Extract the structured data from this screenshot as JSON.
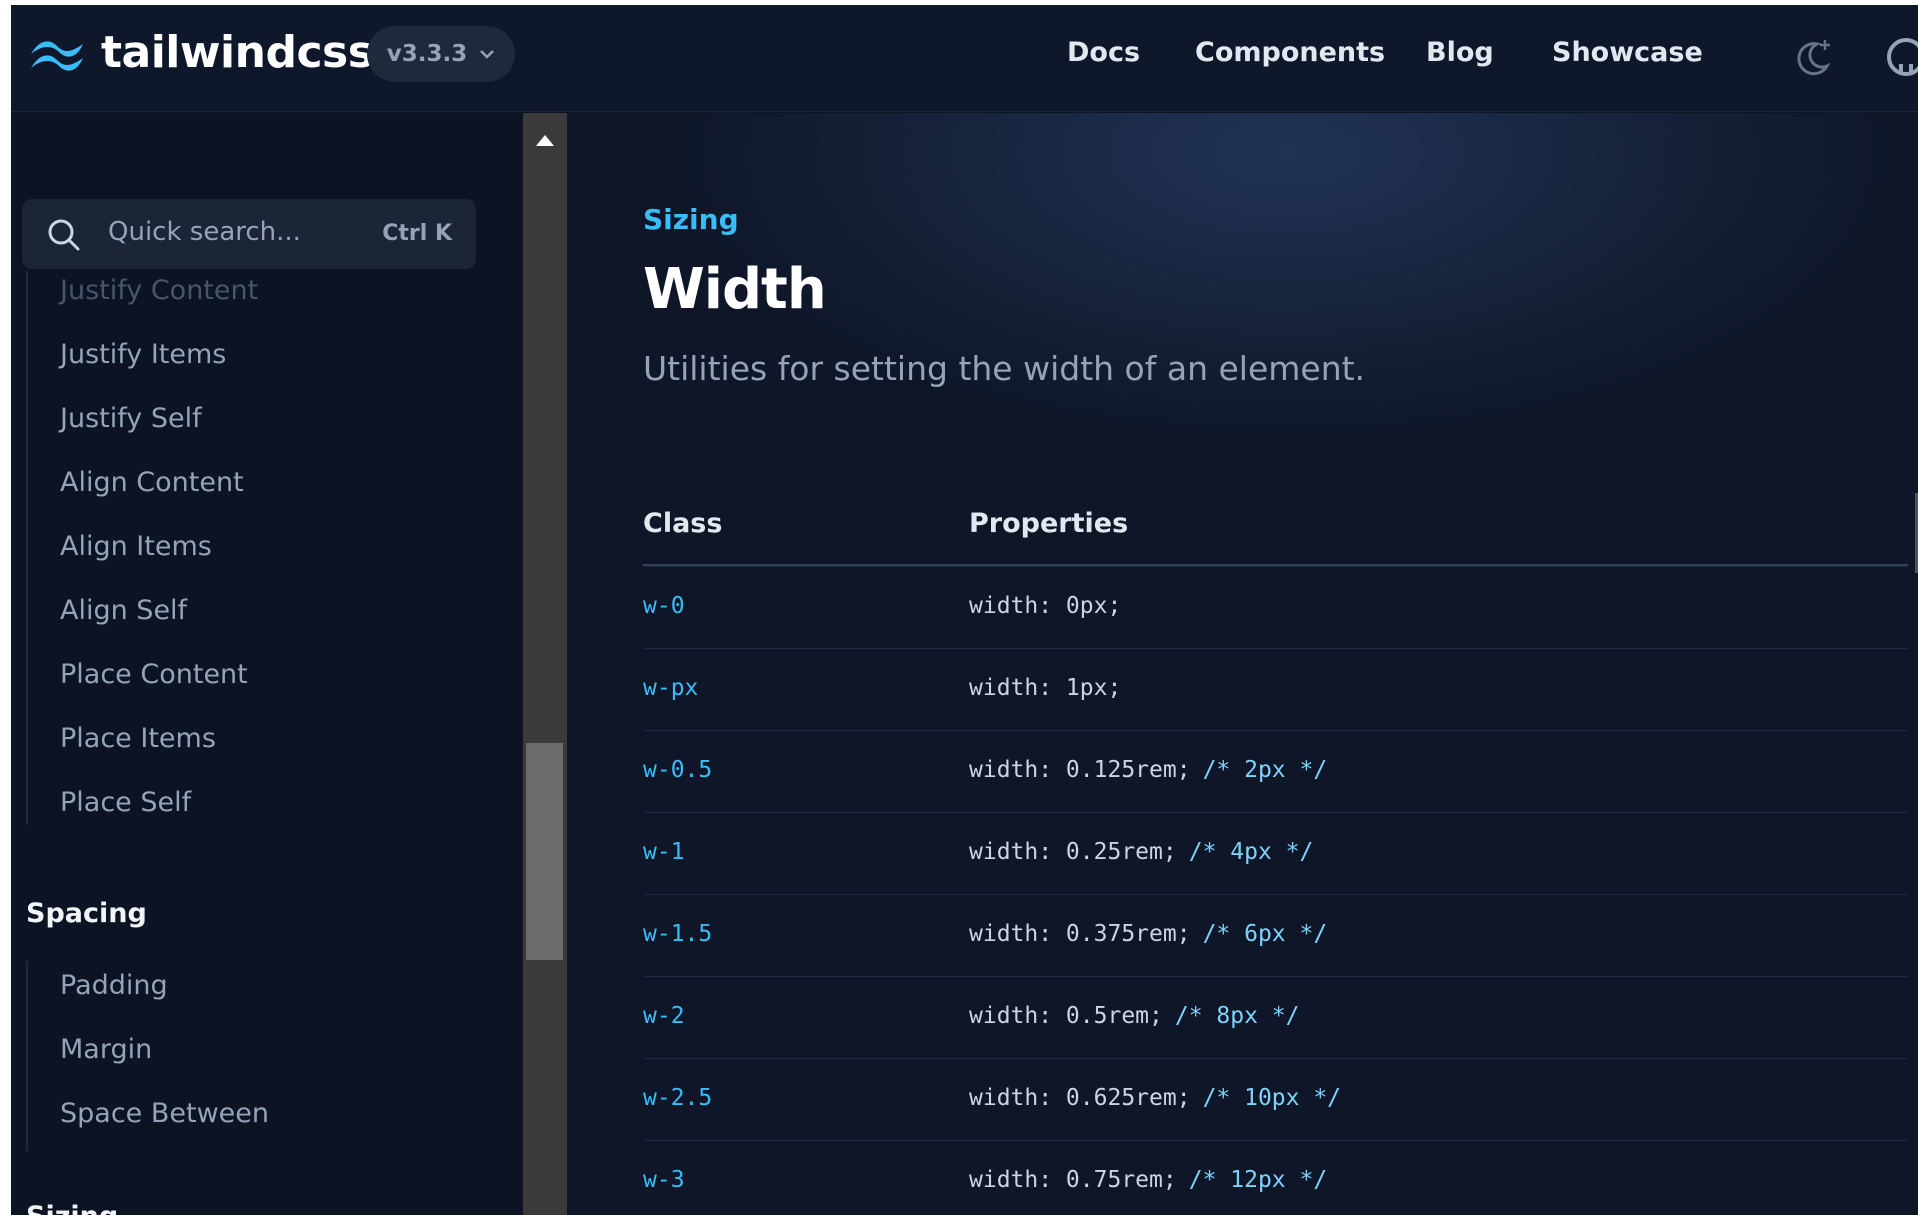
{
  "header": {
    "logo_text": "tailwindcss",
    "version": "v3.3.3",
    "nav": [
      "Docs",
      "Components",
      "Blog",
      "Showcase"
    ]
  },
  "sidebar": {
    "search": {
      "placeholder": "Quick search...",
      "shortcut": "Ctrl K"
    },
    "layout_items_partial": [
      "Justify Content"
    ],
    "items": [
      "Justify Items",
      "Justify Self",
      "Align Content",
      "Align Items",
      "Align Self",
      "Place Content",
      "Place Items",
      "Place Self"
    ],
    "spacing": {
      "heading": "Spacing",
      "items": [
        "Padding",
        "Margin",
        "Space Between"
      ]
    },
    "next_heading_partial": "Sizing"
  },
  "main": {
    "eyebrow": "Sizing",
    "title": "Width",
    "description": "Utilities for setting the width of an element.",
    "table": {
      "headers": [
        "Class",
        "Properties"
      ],
      "rows": [
        {
          "cls": "w-0",
          "prop": "width: 0px;",
          "comment": ""
        },
        {
          "cls": "w-px",
          "prop": "width: 1px;",
          "comment": ""
        },
        {
          "cls": "w-0.5",
          "prop": "width: 0.125rem;",
          "comment": "/* 2px */"
        },
        {
          "cls": "w-1",
          "prop": "width: 0.25rem;",
          "comment": "/* 4px */"
        },
        {
          "cls": "w-1.5",
          "prop": "width: 0.375rem;",
          "comment": "/* 6px */"
        },
        {
          "cls": "w-2",
          "prop": "width: 0.5rem;",
          "comment": "/* 8px */"
        },
        {
          "cls": "w-2.5",
          "prop": "width: 0.625rem;",
          "comment": "/* 10px */"
        },
        {
          "cls": "w-3",
          "prop": "width: 0.75rem;",
          "comment": "/* 12px */"
        }
      ]
    }
  },
  "icons": {
    "logo": "tailwind-wave-icon",
    "version_chevron": "chevron-down-icon",
    "theme": "moon-sparkle-icon",
    "github": "github-icon",
    "search": "search-icon"
  },
  "colors": {
    "accent": "#38bdf8",
    "background": "#0f172a"
  }
}
